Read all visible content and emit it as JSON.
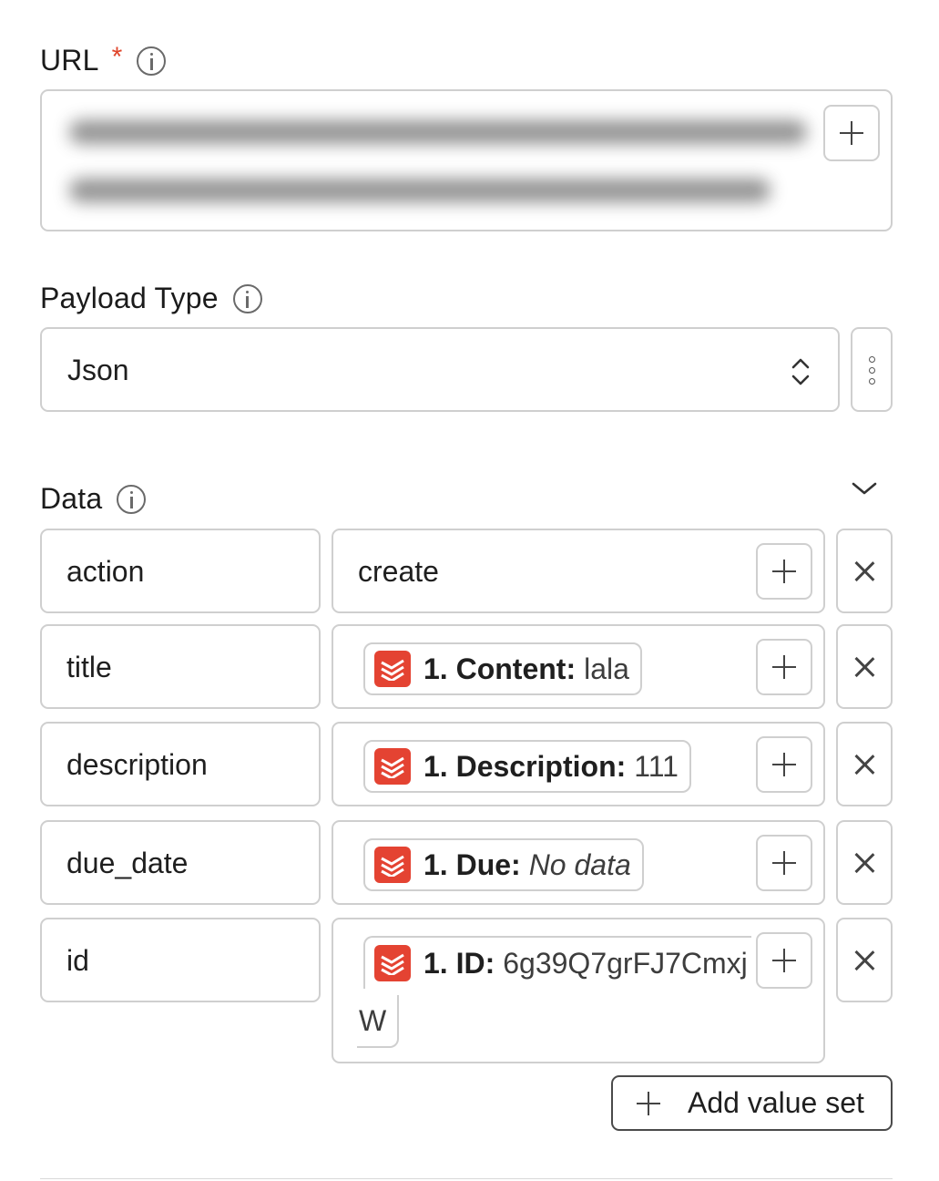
{
  "url_field": {
    "label": "URL",
    "required_mark": "*",
    "value_hidden": true
  },
  "payload_type": {
    "label": "Payload Type",
    "selected": "Json"
  },
  "data_section": {
    "label": "Data",
    "rows": [
      {
        "key": "action",
        "value_text": "create"
      },
      {
        "key": "title",
        "pill_key": "1. Content:",
        "pill_value": "lala",
        "app_icon": "todoist-icon"
      },
      {
        "key": "description",
        "pill_key": "1. Description:",
        "pill_value": "111",
        "app_icon": "todoist-icon"
      },
      {
        "key": "due_date",
        "pill_key": "1. Due:",
        "pill_value": "No data",
        "app_icon": "todoist-icon"
      },
      {
        "key": "id",
        "pill_key": "1. ID:",
        "pill_value": "6g39Q7grFJ7Cmxj",
        "pill_value_wrap": "W",
        "app_icon": "todoist-icon"
      }
    ],
    "add_value_set_label": "Add value set"
  },
  "colors": {
    "required": "#e0452b",
    "app_icon": "#e44332",
    "border": "#cfcfcf"
  }
}
